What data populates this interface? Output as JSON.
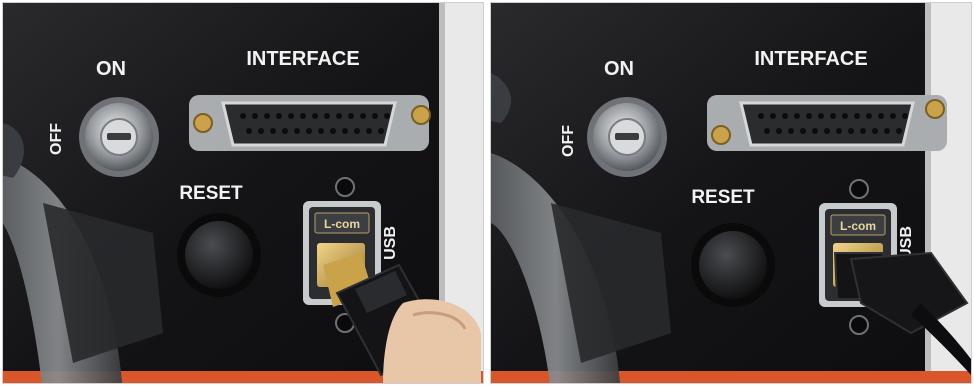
{
  "photos": [
    {
      "panel_labels": {
        "on": "ON",
        "off": "OFF",
        "interface": "INTERFACE",
        "reset": "RESET",
        "usb": "USB"
      },
      "usb_logo": "L-com",
      "step": "cable being inserted"
    },
    {
      "panel_labels": {
        "on": "ON",
        "off": "OFF",
        "interface": "INTERFACE",
        "reset": "RESET",
        "usb": "USB"
      },
      "usb_logo": "L-com",
      "step": "cable fully inserted"
    }
  ],
  "colors": {
    "panel": "#1c1c1e",
    "label": "#f2f2f2",
    "gold": "#c9a24a",
    "chrome": "#bfc3c6",
    "skin": "#e8c6a8"
  }
}
